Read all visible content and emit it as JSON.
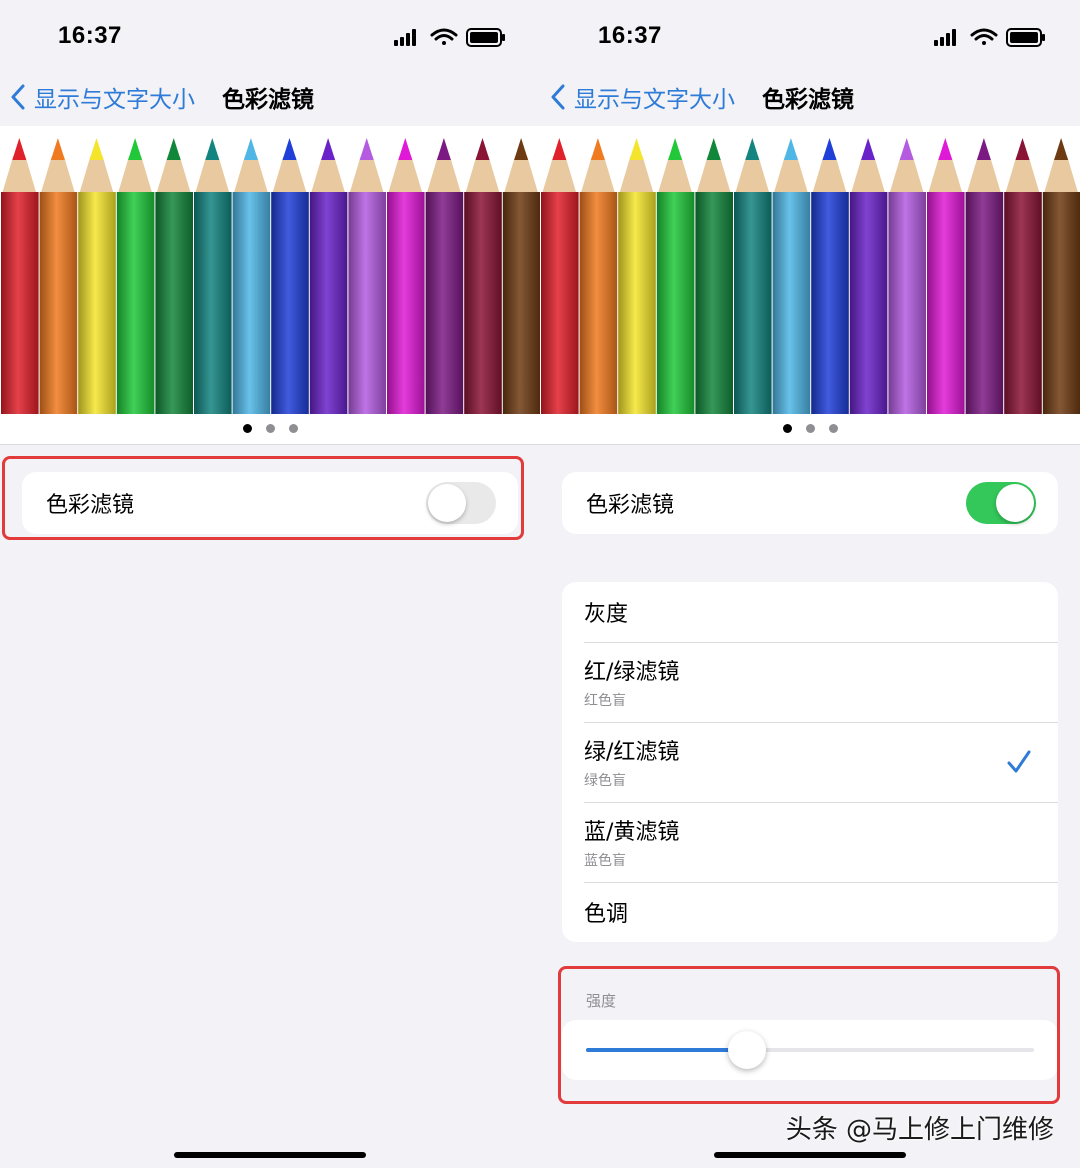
{
  "status_bar": {
    "time": "16:37"
  },
  "nav": {
    "back_label": "显示与文字大小",
    "title": "色彩滤镜"
  },
  "pencil_colors": [
    "#e0202a",
    "#f07a20",
    "#f4e52c",
    "#20c83a",
    "#12863a",
    "#13847f",
    "#4fb6e6",
    "#1f3fd8",
    "#6a22c9",
    "#b45be0",
    "#e019d6",
    "#7c1a83",
    "#8a1436",
    "#6e3a12"
  ],
  "left_screen": {
    "color_filters_label": "色彩滤镜",
    "color_filters_on": false
  },
  "right_screen": {
    "color_filters_label": "色彩滤镜",
    "color_filters_on": true,
    "filters": [
      {
        "label": "灰度",
        "sub": "",
        "selected": false
      },
      {
        "label": "红/绿滤镜",
        "sub": "红色盲",
        "selected": false
      },
      {
        "label": "绿/红滤镜",
        "sub": "绿色盲",
        "selected": true
      },
      {
        "label": "蓝/黄滤镜",
        "sub": "蓝色盲",
        "selected": false
      },
      {
        "label": "色调",
        "sub": "",
        "selected": false
      }
    ],
    "intensity_label": "强度",
    "intensity_value": 0.36
  },
  "watermark": "头条 @马上修上门维修"
}
